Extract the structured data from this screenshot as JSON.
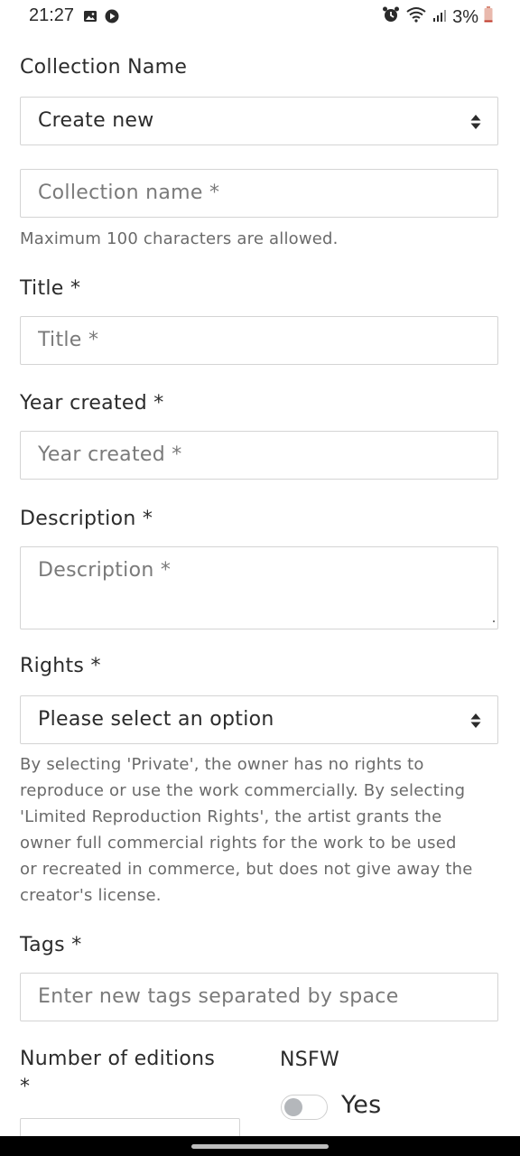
{
  "status_bar": {
    "time": "21:27",
    "battery": "3%",
    "left_icons": [
      "image-icon",
      "play-circle-icon"
    ],
    "right_icons": [
      "alarm-icon",
      "wifi-icon",
      "signal-icon",
      "battery-icon"
    ]
  },
  "collection": {
    "label": "Collection Name",
    "select_value": "Create new",
    "name_placeholder": "Collection name *",
    "name_help": "Maximum 100 characters are allowed."
  },
  "title": {
    "label": "Title *",
    "placeholder": "Title *"
  },
  "year": {
    "label": "Year created *",
    "placeholder": "Year created *"
  },
  "description": {
    "label": "Description *",
    "placeholder": "Description *"
  },
  "rights": {
    "label": "Rights *",
    "select_value": "Please select an option",
    "help_lines": [
      "By selecting 'Private', the owner has no rights to",
      "reproduce or use the work commercially. By selecting",
      "'Limited Reproduction Rights', the artist grants the",
      "owner full commercial rights for the work to be used",
      "or recreated in commerce, but does not give away the",
      "creator's license."
    ]
  },
  "tags": {
    "label": "Tags *",
    "placeholder": "Enter new tags separated by space"
  },
  "editions": {
    "label_line1": "Number of editions",
    "label_line2": "*"
  },
  "nsfw": {
    "label": "NSFW",
    "toggle_label": "Yes",
    "enabled": false
  }
}
